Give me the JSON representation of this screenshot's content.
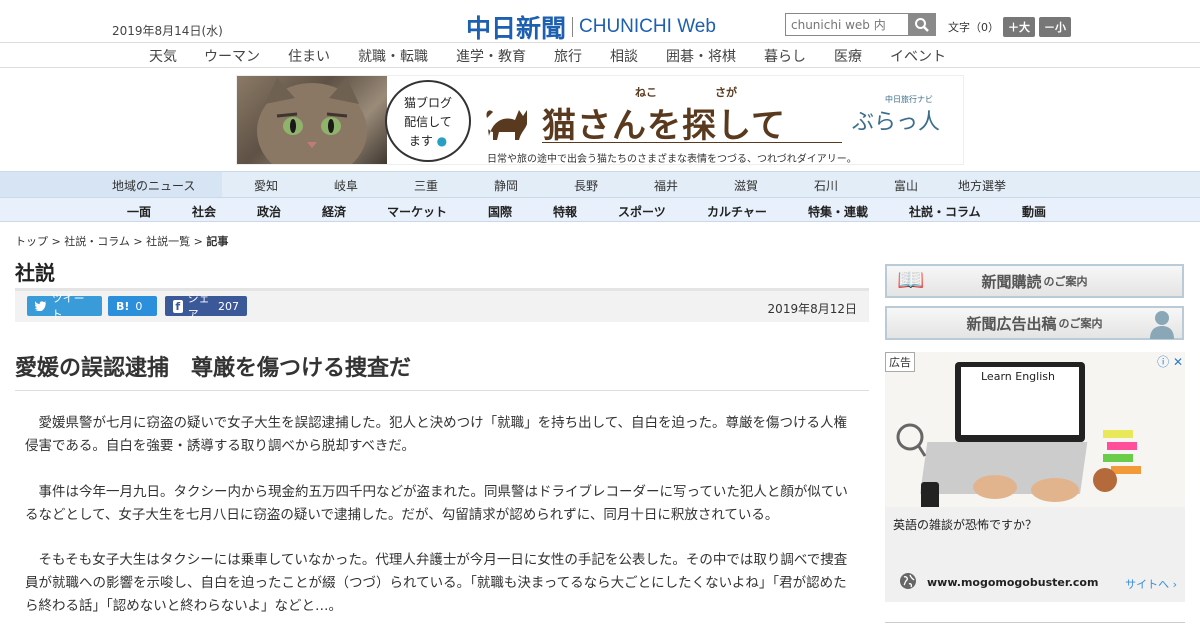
{
  "header": {
    "date": "2019年8月14日(水)",
    "logo_jp": "中日新聞",
    "logo_en_a": "CHUNICHI",
    "logo_en_b": "Web",
    "search_placeholder": "chunichi web 内",
    "fontsize_label": "文字（0）",
    "fontsize_up": "＋大",
    "fontsize_down": "－小"
  },
  "topnav": [
    "天気",
    "ウーマン",
    "住まい",
    "就職・転職",
    "進学・教育",
    "旅行",
    "相談",
    "囲碁・将棋",
    "暮らし",
    "医療",
    "イベント"
  ],
  "banner": {
    "bubble_lines": [
      "猫ブログ",
      "配信して",
      "ます"
    ],
    "title": "猫さんを探して",
    "ruby_left": "ねこ",
    "ruby_right": "さが",
    "small": "中日旅行ナビ",
    "brand": "ぶらっ人",
    "sub": "日常や旅の途中で出会う猫たちのさまざまな表情をつづる、つれづれダイアリー。"
  },
  "regionnav": {
    "label": "地域のニュース",
    "items": [
      "愛知",
      "岐阜",
      "三重",
      "静岡",
      "長野",
      "福井",
      "滋賀",
      "石川",
      "富山",
      "地方選挙"
    ]
  },
  "sectionnav": [
    "一面",
    "社会",
    "政治",
    "経済",
    "マーケット",
    "国際",
    "特報",
    "スポーツ",
    "カルチャー",
    "特集・連載",
    "社説・コラム",
    "動画"
  ],
  "breadcrumb": {
    "items": [
      "トップ",
      "社説・コラム",
      "社説一覧"
    ],
    "current": "記事",
    "sep": " > "
  },
  "section_title": "社説",
  "share": {
    "tweet": "ツイート",
    "hatena": "B!",
    "hatena_count": "0",
    "facebook": "シェア",
    "facebook_count": "207"
  },
  "pubdate": "2019年8月12日",
  "headline": "愛媛の誤認逮捕　尊厳を傷つける捜査だ",
  "paragraphs": [
    "　愛媛県警が七月に窃盗の疑いで女子大生を誤認逮捕した。犯人と決めつけ「就職」を持ち出して、自白を迫った。尊厳を傷つける人権侵害である。自白を強要・誘導する取り調べから脱却すべきだ。",
    "　事件は今年一月九日。タクシー内から現金約五万四千円などが盗まれた。同県警はドライブレコーダーに写っていた犯人と顔が似ているなどとして、女子大生を七月八日に窃盗の疑いで逮捕した。だが、勾留請求が認められずに、同月十日に釈放されている。",
    "　そもそも女子大生はタクシーには乗車していなかった。代理人弁護士が今月一日に女性の手記を公表した。その中では取り調べで捜査員が就職への影響を示唆し、自白を迫ったことが綴（つづ）られている。「就職も決まってるなら大ごとにしたくないよね」「君が認めたら終わる話」「認めないと終わらないよ」などと…。"
  ],
  "sidebar": {
    "subscribe": "新聞購読",
    "subscribe_suffix": "のご案内",
    "adcontact": "新聞広告出稿",
    "adcontact_suffix": "のご案内"
  },
  "ad": {
    "tag": "広告",
    "screen_text": "Learn English",
    "text": "英語の雑談が恐怖ですか？",
    "domain": "www.mogomogobuster.com",
    "site_link": "サイトへ"
  }
}
